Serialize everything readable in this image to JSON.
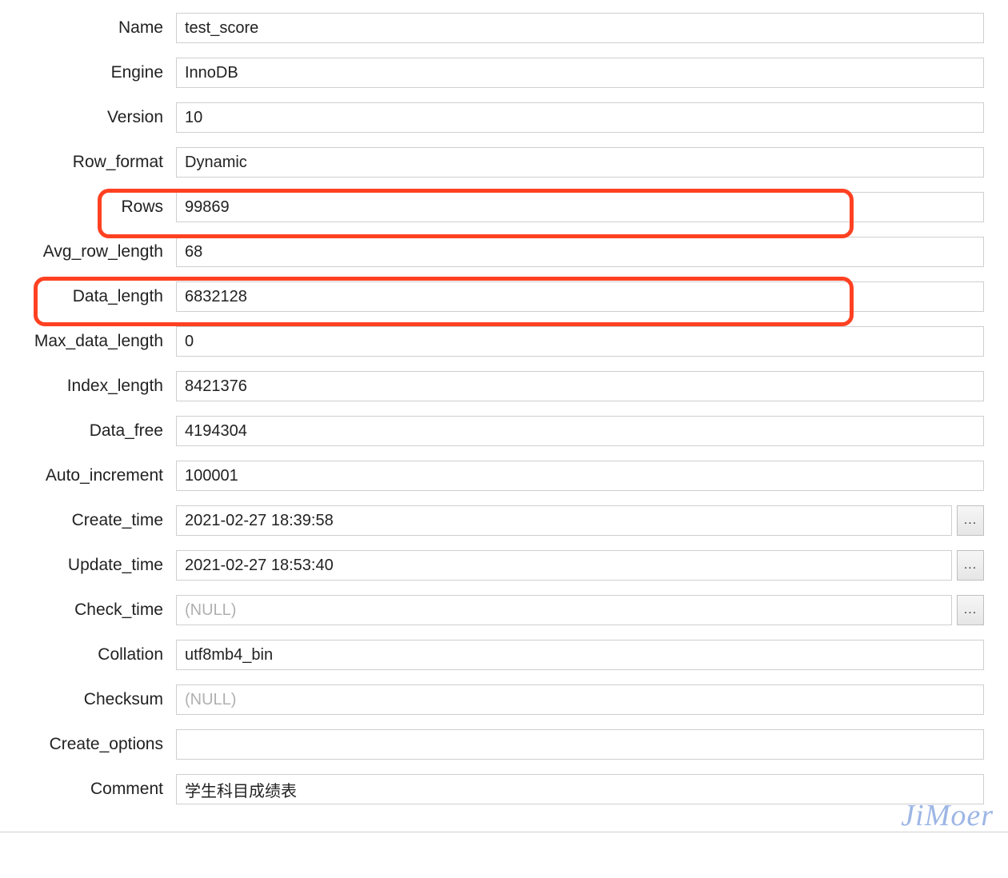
{
  "fields": {
    "name": {
      "label": "Name",
      "value": "test_score",
      "null": false,
      "picker": false
    },
    "engine": {
      "label": "Engine",
      "value": "InnoDB",
      "null": false,
      "picker": false
    },
    "version": {
      "label": "Version",
      "value": "10",
      "null": false,
      "picker": false
    },
    "row_format": {
      "label": "Row_format",
      "value": "Dynamic",
      "null": false,
      "picker": false
    },
    "rows": {
      "label": "Rows",
      "value": "99869",
      "null": false,
      "picker": false
    },
    "avg_row_length": {
      "label": "Avg_row_length",
      "value": "68",
      "null": false,
      "picker": false
    },
    "data_length": {
      "label": "Data_length",
      "value": "6832128",
      "null": false,
      "picker": false
    },
    "max_data_length": {
      "label": "Max_data_length",
      "value": "0",
      "null": false,
      "picker": false
    },
    "index_length": {
      "label": "Index_length",
      "value": "8421376",
      "null": false,
      "picker": false
    },
    "data_free": {
      "label": "Data_free",
      "value": "4194304",
      "null": false,
      "picker": false
    },
    "auto_increment": {
      "label": "Auto_increment",
      "value": "100001",
      "null": false,
      "picker": false
    },
    "create_time": {
      "label": "Create_time",
      "value": "2021-02-27 18:39:58",
      "null": false,
      "picker": true
    },
    "update_time": {
      "label": "Update_time",
      "value": "2021-02-27 18:53:40",
      "null": false,
      "picker": true
    },
    "check_time": {
      "label": "Check_time",
      "value": "(NULL)",
      "null": true,
      "picker": true
    },
    "collation": {
      "label": "Collation",
      "value": "utf8mb4_bin",
      "null": false,
      "picker": false
    },
    "checksum": {
      "label": "Checksum",
      "value": "(NULL)",
      "null": true,
      "picker": false
    },
    "create_options": {
      "label": "Create_options",
      "value": "",
      "null": false,
      "picker": false
    },
    "comment": {
      "label": "Comment",
      "value": "学生科目成绩表",
      "null": false,
      "picker": false
    }
  },
  "picker_label": "...",
  "watermark": "JiMoer"
}
